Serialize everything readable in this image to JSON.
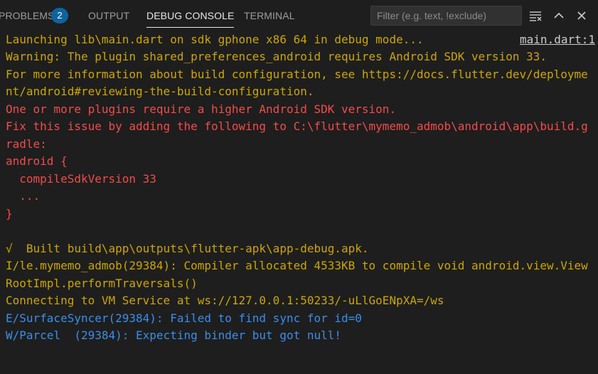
{
  "tabs": {
    "problems": {
      "label": "PROBLEMS",
      "count": "2"
    },
    "output": {
      "label": "OUTPUT"
    },
    "debug_console": {
      "label": "DEBUG CONSOLE"
    },
    "terminal": {
      "label": "TERMINAL"
    }
  },
  "filter": {
    "placeholder": "Filter (e.g. text, !exclude)",
    "value": ""
  },
  "icons": {
    "collapse": "collapse-all-icon",
    "chevron_up": "chevron-up-icon",
    "close": "close-icon"
  },
  "colors": {
    "warning": "#cca700",
    "error": "#f14c4c",
    "info": "#3b8eea",
    "badge": "#0e639c"
  },
  "console": {
    "source_link": "main.dart:1",
    "lines": [
      "Launching lib\\main.dart on sdk gphone x86 64 in debug mode...",
      "Warning: The plugin shared_preferences_android requires Android SDK version 33.",
      "For more information about build configuration, see https://docs.flutter.dev/deployme",
      "nt/android#reviewing-the-build-configuration.",
      "One or more plugins require a higher Android SDK version.",
      "Fix this issue by adding the following to C:\\flutter\\mymemo_admob\\android\\app\\build.g",
      "radle:",
      "android {",
      "  compileSdkVersion 33",
      "  ...",
      "}",
      "",
      "√  Built build\\app\\outputs\\flutter-apk\\app-debug.apk.",
      "I/le.mymemo_admob(29384): Compiler allocated 4533KB to compile void android.view.View",
      "RootImpl.performTraversals()",
      "Connecting to VM Service at ws://127.0.0.1:50233/-uLlGoENpXA=/ws",
      "E/SurfaceSyncer(29384): Failed to find sync for id=0",
      "W/Parcel  (29384): Expecting binder but got null!"
    ]
  }
}
